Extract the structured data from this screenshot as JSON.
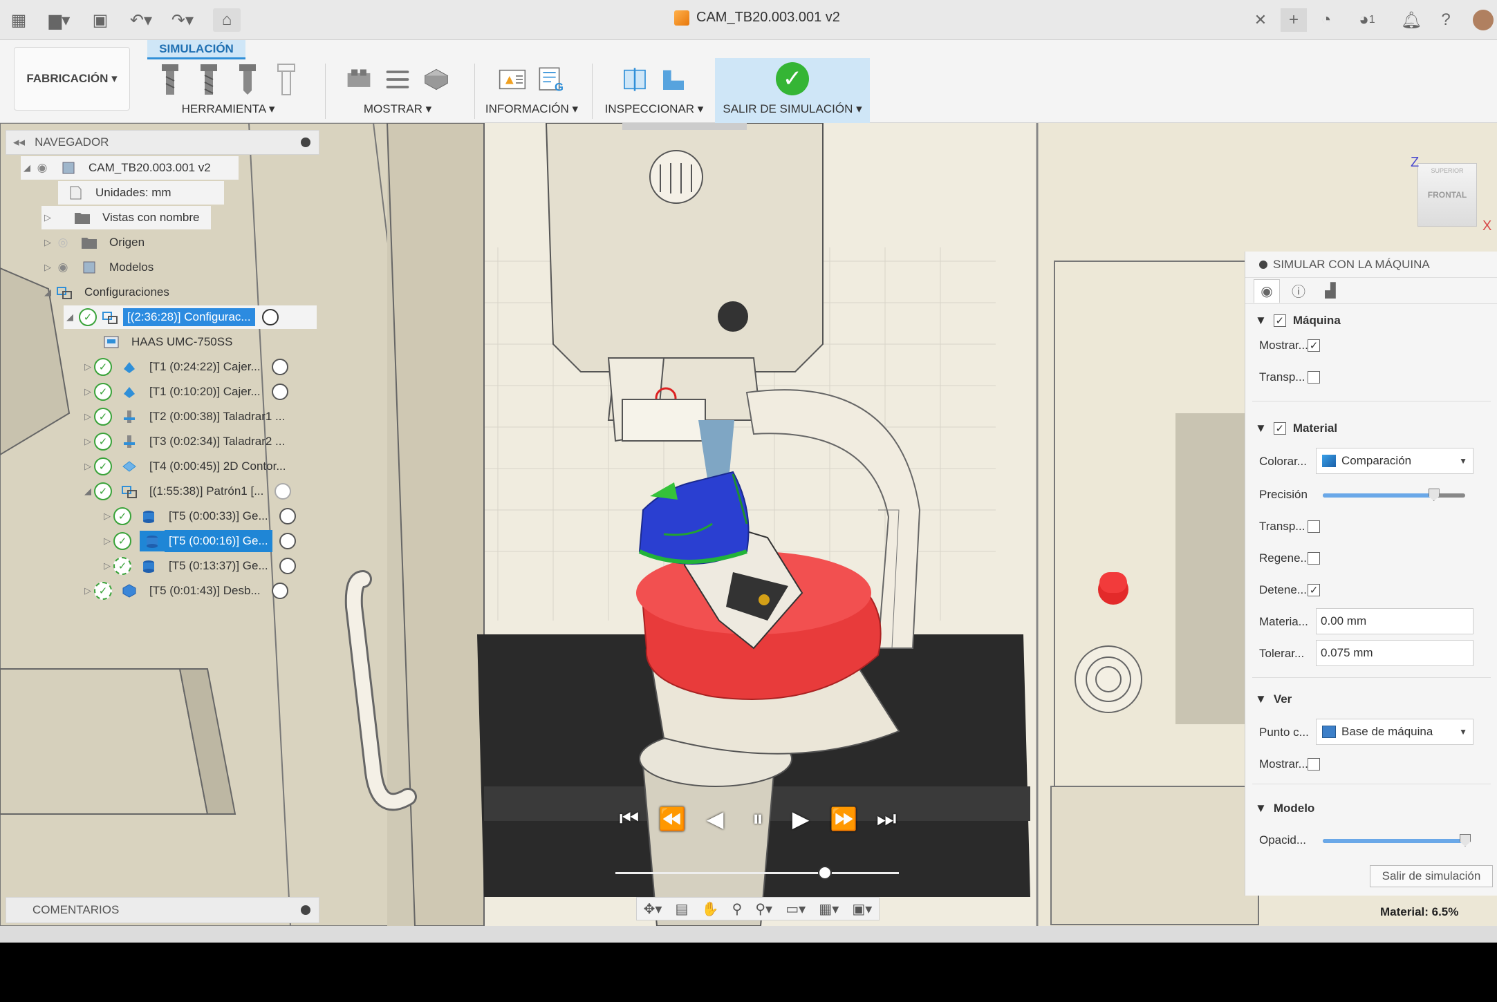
{
  "window": {
    "title": "CAM_TB20.003.001 v2",
    "notification_count": "1"
  },
  "ribbon": {
    "active_tab": "SIMULACIÓN",
    "workspace": "FABRICACIÓN",
    "groups": [
      {
        "label": "HERRAMIENTA"
      },
      {
        "label": "MOSTRAR"
      },
      {
        "label": "INFORMACIÓN"
      },
      {
        "label": "INSPECCIONAR"
      },
      {
        "label": "SALIR DE SIMULACIÓN"
      }
    ]
  },
  "navigator": {
    "title": "NAVEGADOR",
    "items": [
      {
        "label": "CAM_TB20.003.001 v2"
      },
      {
        "label": "Unidades: mm"
      },
      {
        "label": "Vistas con nombre"
      },
      {
        "label": "Origen"
      },
      {
        "label": "Modelos"
      },
      {
        "label": "Configuraciones"
      },
      {
        "label": "[(2:36:28)] Configurac..."
      },
      {
        "label": "HAAS UMC-750SS"
      },
      {
        "label": "[T1 (0:24:22)] Cajer..."
      },
      {
        "label": "[T1 (0:10:20)] Cajer..."
      },
      {
        "label": "[T2 (0:00:38)] Taladrar1 ..."
      },
      {
        "label": "[T3 (0:02:34)] Taladrar2 ..."
      },
      {
        "label": "[T4 (0:00:45)] 2D Contor..."
      },
      {
        "label": "[(1:55:38)] Patrón1 [..."
      },
      {
        "label": "[T5 (0:00:33)] Ge..."
      },
      {
        "label": "[T5 (0:00:16)] Ge..."
      },
      {
        "label": "[T5 (0:13:37)] Ge..."
      },
      {
        "label": "[T5 (0:01:43)] Desb..."
      }
    ]
  },
  "viewcube": {
    "face": "FRONTAL",
    "axis_z": "Z",
    "axis_x": "X",
    "top": "SUPERIOR"
  },
  "sim_panel": {
    "title": "SIMULAR CON LA MÁQUINA",
    "machine": {
      "title": "Máquina",
      "show_label": "Mostrar...",
      "transp_label": "Transp..."
    },
    "material": {
      "title": "Material",
      "color_label": "Colorar...",
      "color_value": "Comparación",
      "precision_label": "Precisión",
      "precision_value": 0.78,
      "transp_label": "Transp...",
      "regen_label": "Regene...",
      "stop_label": "Detene...",
      "material_label": "Materia...",
      "material_value": "0.00 mm",
      "tolerance_label": "Tolerar...",
      "tolerance_value": "0.075 mm"
    },
    "view": {
      "title": "Ver",
      "point_label": "Punto c...",
      "point_value": "Base de máquina",
      "show_label": "Mostrar..."
    },
    "model": {
      "title": "Modelo",
      "opacity_label": "Opacid...",
      "opacity_value": 1.0
    },
    "exit_button": "Salir de simulación"
  },
  "timeline": {
    "position": 0.74
  },
  "bottom": {
    "comments": "COMENTARIOS",
    "material_status": "Material: 6.5%"
  }
}
